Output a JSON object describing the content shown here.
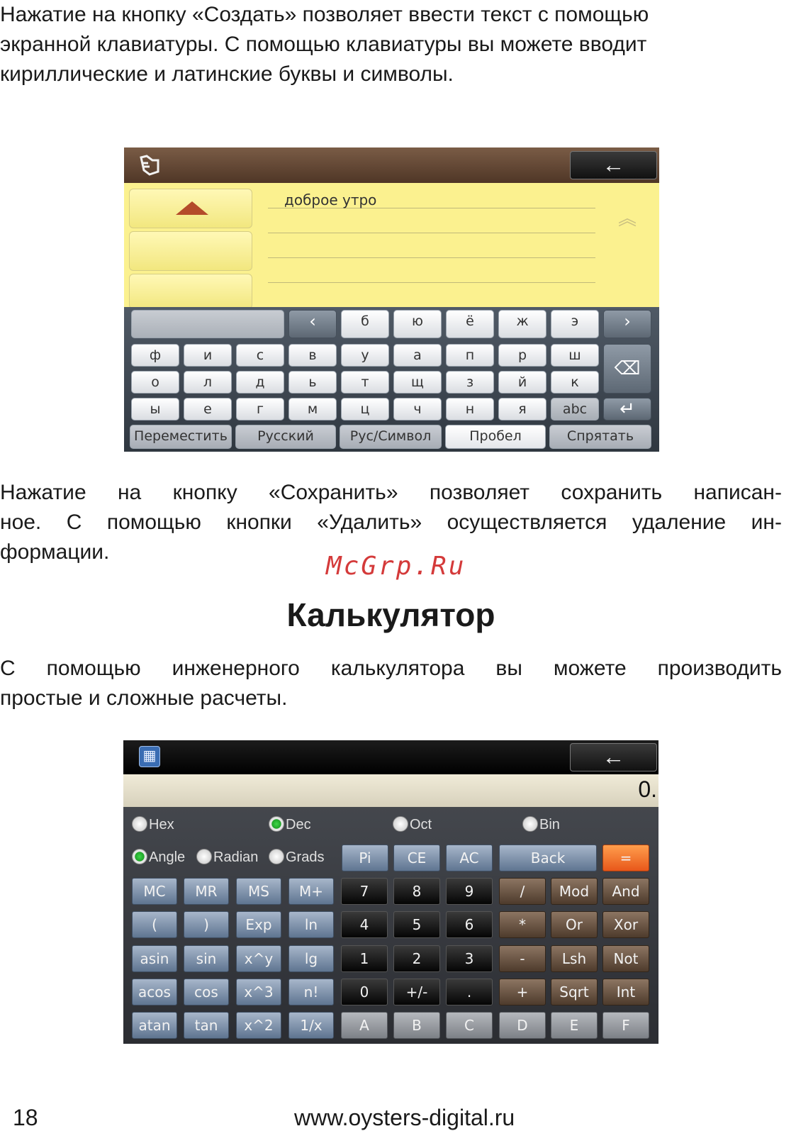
{
  "paragraph1": [
    "Нажатие на кнопку «Создать» позволяет ввести текст с помощью",
    "экранной клавиатуры. С помощью клавиатуры вы можете вводит",
    "кириллические и латинские буквы и символы."
  ],
  "paragraph2": [
    "Нажатие на кнопку «Сохранить» позволяет сохранить написан-",
    "ное. С помощью кнопки «Удалить» осуществляется удаление ин-",
    "формации."
  ],
  "heading": "Калькулятор",
  "paragraph3": [
    "С помощью инженерного калькулятора вы можете производить",
    "простые и сложные расчеты."
  ],
  "watermark": "McGrp.Ru",
  "footer": {
    "page_number": "18",
    "url": "www.oysters-digital.ru"
  },
  "keyboard": {
    "icons": {
      "header": "hand-pointer-icon",
      "back": "arrow-left-icon",
      "up": "triangle-up-icon",
      "scroll": "double-chevron-up-icon"
    },
    "note_text": "доброе утро",
    "row1": [
      "‹",
      "б",
      "ю",
      "ё",
      "ж",
      "э",
      "›"
    ],
    "row2": [
      "ф",
      "и",
      "с",
      "в",
      "у",
      "а",
      "п",
      "р",
      "ш"
    ],
    "row3": [
      "о",
      "л",
      "д",
      "ь",
      "т",
      "щ",
      "з",
      "й",
      "к"
    ],
    "row4": [
      "ы",
      "е",
      "г",
      "м",
      "ц",
      "ч",
      "н",
      "я",
      "abc"
    ],
    "backspace": "⌫",
    "enter": "↵",
    "bottom": [
      "Переместить",
      "Русский",
      "Рус/Символ",
      "Пробел",
      "Спрятать"
    ]
  },
  "calculator": {
    "icons": {
      "app": "grid-icon",
      "back": "arrow-left-icon"
    },
    "display": "0.",
    "bases": [
      {
        "label": "Hex",
        "selected": false
      },
      {
        "label": "Dec",
        "selected": true
      },
      {
        "label": "Oct",
        "selected": false
      },
      {
        "label": "Bin",
        "selected": false
      }
    ],
    "angles": [
      {
        "label": "Angle",
        "selected": true
      },
      {
        "label": "Radian",
        "selected": false
      },
      {
        "label": "Grads",
        "selected": false
      }
    ],
    "row0": [
      "Pi",
      "CE",
      "AC",
      "Back",
      "="
    ],
    "rows": [
      [
        "MC",
        "MR",
        "MS",
        "M+",
        "7",
        "8",
        "9",
        "/",
        "Mod",
        "And"
      ],
      [
        "(",
        ")",
        "Exp",
        "ln",
        "4",
        "5",
        "6",
        "*",
        "Or",
        "Xor"
      ],
      [
        "asin",
        "sin",
        "x^y",
        "lg",
        "1",
        "2",
        "3",
        "-",
        "Lsh",
        "Not"
      ],
      [
        "acos",
        "cos",
        "x^3",
        "n!",
        "0",
        "+/-",
        ".",
        "+",
        "Sqrt",
        "Int"
      ],
      [
        "atan",
        "tan",
        "x^2",
        "1/x",
        "A",
        "B",
        "C",
        "D",
        "E",
        "F"
      ]
    ]
  }
}
